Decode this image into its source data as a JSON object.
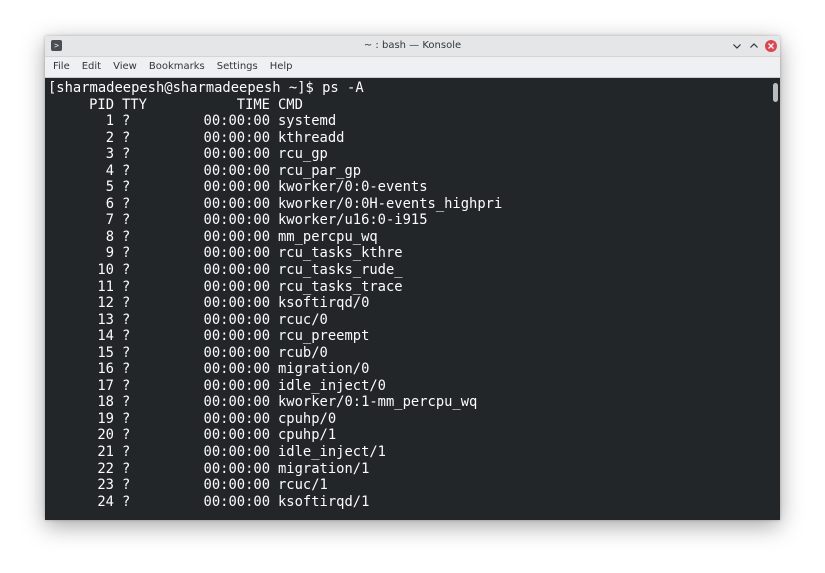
{
  "window": {
    "title": "~ : bash — Konsole",
    "app_icon": "terminal-icon",
    "app_icon_glyph": ">",
    "controls": [
      "chevron-down-icon",
      "chevron-up-icon",
      "close-icon"
    ]
  },
  "menubar": {
    "items": [
      "File",
      "Edit",
      "View",
      "Bookmarks",
      "Settings",
      "Help"
    ]
  },
  "terminal": {
    "prompt": "[sharmadeepesh@sharmadeepesh ~]$ ps -A",
    "headers": {
      "pid": "PID",
      "tty": "TTY",
      "time": "TIME",
      "cmd": "CMD"
    },
    "rows": [
      {
        "pid": "1",
        "tty": "?",
        "time": "00:00:00",
        "cmd": "systemd"
      },
      {
        "pid": "2",
        "tty": "?",
        "time": "00:00:00",
        "cmd": "kthreadd"
      },
      {
        "pid": "3",
        "tty": "?",
        "time": "00:00:00",
        "cmd": "rcu_gp"
      },
      {
        "pid": "4",
        "tty": "?",
        "time": "00:00:00",
        "cmd": "rcu_par_gp"
      },
      {
        "pid": "5",
        "tty": "?",
        "time": "00:00:00",
        "cmd": "kworker/0:0-events"
      },
      {
        "pid": "6",
        "tty": "?",
        "time": "00:00:00",
        "cmd": "kworker/0:0H-events_highpri"
      },
      {
        "pid": "7",
        "tty": "?",
        "time": "00:00:00",
        "cmd": "kworker/u16:0-i915"
      },
      {
        "pid": "8",
        "tty": "?",
        "time": "00:00:00",
        "cmd": "mm_percpu_wq"
      },
      {
        "pid": "9",
        "tty": "?",
        "time": "00:00:00",
        "cmd": "rcu_tasks_kthre"
      },
      {
        "pid": "10",
        "tty": "?",
        "time": "00:00:00",
        "cmd": "rcu_tasks_rude_"
      },
      {
        "pid": "11",
        "tty": "?",
        "time": "00:00:00",
        "cmd": "rcu_tasks_trace"
      },
      {
        "pid": "12",
        "tty": "?",
        "time": "00:00:00",
        "cmd": "ksoftirqd/0"
      },
      {
        "pid": "13",
        "tty": "?",
        "time": "00:00:00",
        "cmd": "rcuc/0"
      },
      {
        "pid": "14",
        "tty": "?",
        "time": "00:00:00",
        "cmd": "rcu_preempt"
      },
      {
        "pid": "15",
        "tty": "?",
        "time": "00:00:00",
        "cmd": "rcub/0"
      },
      {
        "pid": "16",
        "tty": "?",
        "time": "00:00:00",
        "cmd": "migration/0"
      },
      {
        "pid": "17",
        "tty": "?",
        "time": "00:00:00",
        "cmd": "idle_inject/0"
      },
      {
        "pid": "18",
        "tty": "?",
        "time": "00:00:00",
        "cmd": "kworker/0:1-mm_percpu_wq"
      },
      {
        "pid": "19",
        "tty": "?",
        "time": "00:00:00",
        "cmd": "cpuhp/0"
      },
      {
        "pid": "20",
        "tty": "?",
        "time": "00:00:00",
        "cmd": "cpuhp/1"
      },
      {
        "pid": "21",
        "tty": "?",
        "time": "00:00:00",
        "cmd": "idle_inject/1"
      },
      {
        "pid": "22",
        "tty": "?",
        "time": "00:00:00",
        "cmd": "migration/1"
      },
      {
        "pid": "23",
        "tty": "?",
        "time": "00:00:00",
        "cmd": "rcuc/1"
      },
      {
        "pid": "24",
        "tty": "?",
        "time": "00:00:00",
        "cmd": "ksoftirqd/1"
      }
    ]
  },
  "colors": {
    "terminal_bg": "#232629",
    "terminal_fg": "#fcfcfc",
    "close_button": "#e3414f",
    "titlebar_bg": "#e5e6e8"
  }
}
